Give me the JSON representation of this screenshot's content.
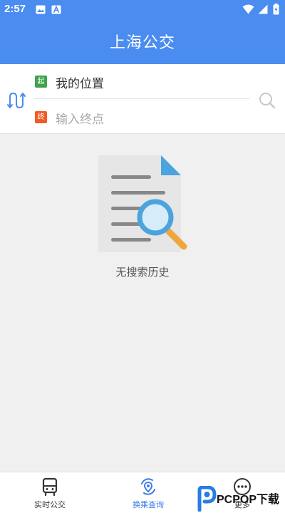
{
  "status_bar": {
    "time": "2:57",
    "icons": [
      "image-icon",
      "a-notification-icon",
      "wifi-icon",
      "signal-icon",
      "battery-icon"
    ]
  },
  "app_bar": {
    "title": "上海公交"
  },
  "search": {
    "start_badge": "起",
    "end_badge": "终",
    "from_value": "我的位置",
    "to_placeholder": "输入终点"
  },
  "empty_state": {
    "message": "无搜索历史"
  },
  "bottom_nav": {
    "items": [
      {
        "label": "实时公交",
        "icon": "bus-icon"
      },
      {
        "label": "换乘查询",
        "icon": "route-icon",
        "active": true
      },
      {
        "label": "更多",
        "icon": "more-icon"
      }
    ]
  },
  "watermark": {
    "text": "PCPOP下载"
  },
  "colors": {
    "primary": "#4a8cf0",
    "start_green": "#3ea34a",
    "end_orange": "#f05a25",
    "active_nav": "#3b7ce8"
  }
}
